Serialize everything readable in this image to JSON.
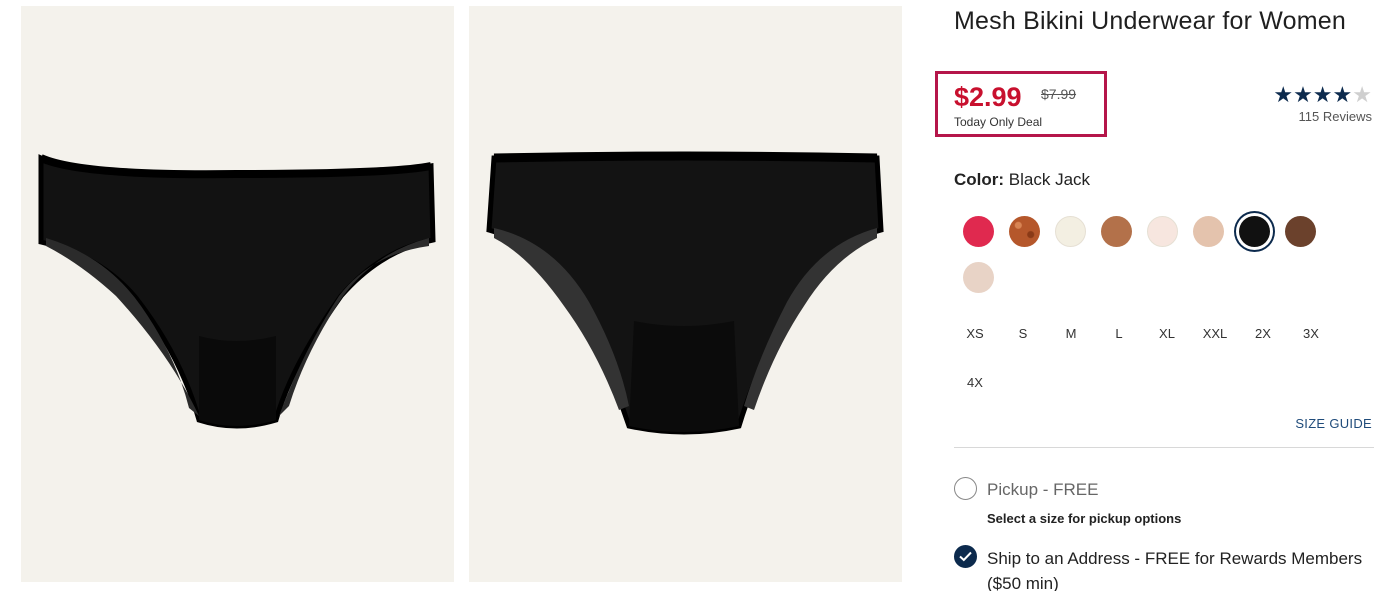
{
  "product": {
    "title": "Mesh Bikini Underwear for Women",
    "price_now": "$2.99",
    "price_was": "$7.99",
    "deal_label": "Today Only Deal",
    "rating": 4,
    "rating_max": 5,
    "reviews_label": "115 Reviews"
  },
  "color": {
    "label": "Color:",
    "selected": "Black Jack",
    "swatches": [
      {
        "name": "red",
        "color": "#e0294f"
      },
      {
        "name": "copper-print",
        "color": "#b5572b"
      },
      {
        "name": "cream",
        "color": "#f3efe2"
      },
      {
        "name": "caramel",
        "color": "#b3714a"
      },
      {
        "name": "light-pink",
        "color": "#f7e6df"
      },
      {
        "name": "nude",
        "color": "#e4c3ad"
      },
      {
        "name": "black-jack",
        "color": "#111111",
        "selected": true
      },
      {
        "name": "brown",
        "color": "#6b412c"
      },
      {
        "name": "blush",
        "color": "#e8d3c6"
      }
    ]
  },
  "sizes": [
    "XS",
    "S",
    "M",
    "L",
    "XL",
    "XXL",
    "2X",
    "3X",
    "4X"
  ],
  "size_guide": "SIZE GUIDE",
  "fulfillment": {
    "pickup_label": "Pickup - FREE",
    "pickup_note": "Select a size for pickup options",
    "ship_label": "Ship to an Address - FREE for Rewards Members ($50 min)"
  },
  "colors": {
    "sale": "#c8102e",
    "navy": "#0c2a4d",
    "highlight_box": "#b5164a",
    "photo_bg": "#f4f2ec"
  }
}
